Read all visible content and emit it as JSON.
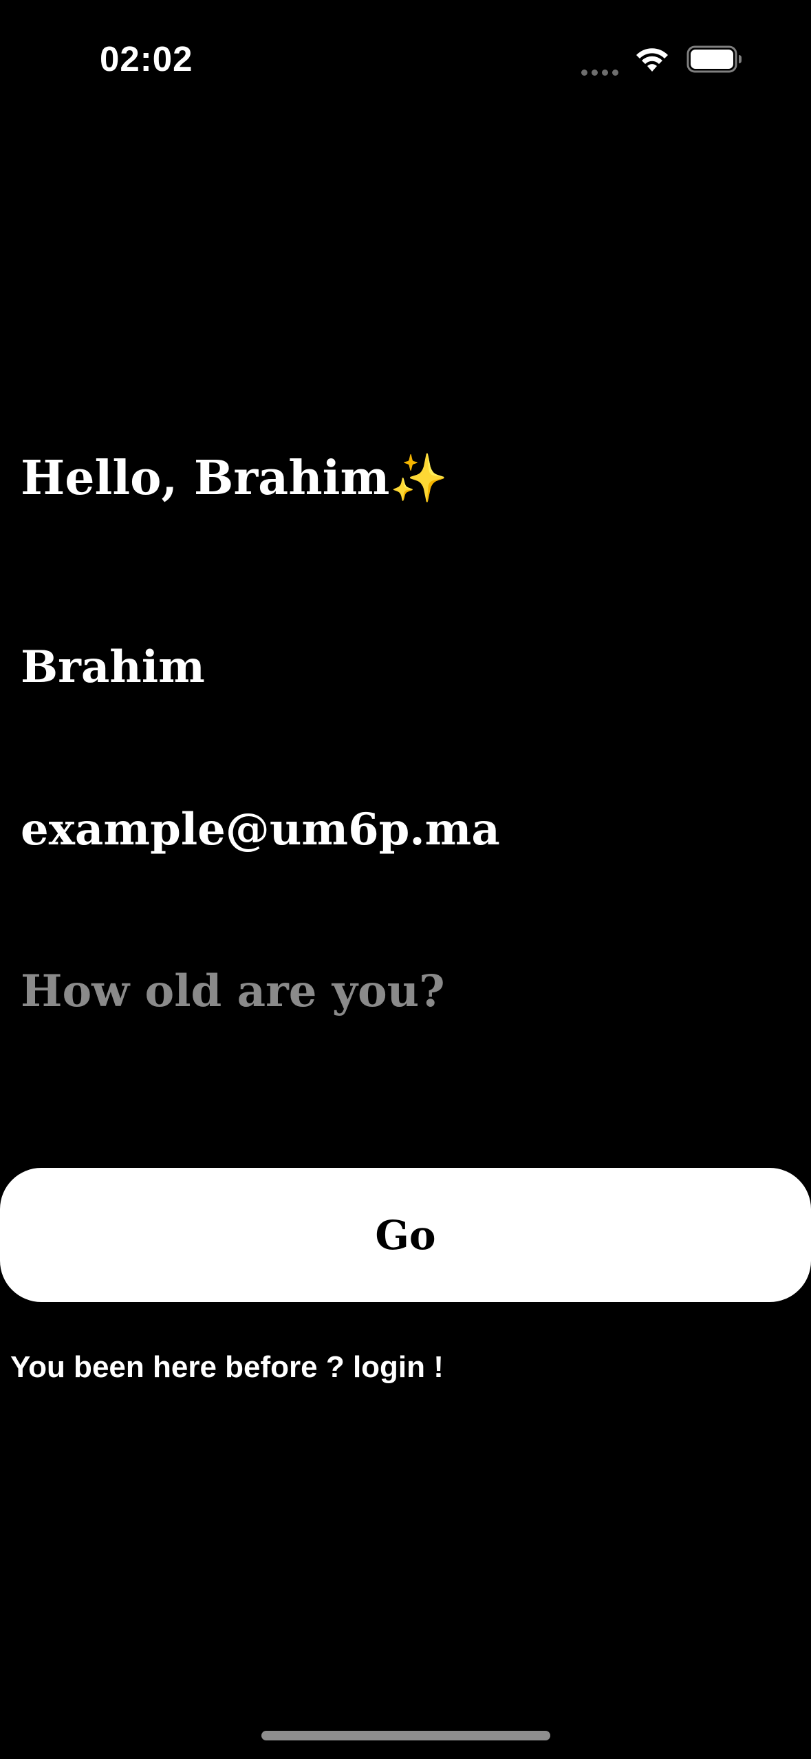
{
  "status_bar": {
    "time": "02:02",
    "icons": [
      "signal-dots-icon",
      "wifi-icon",
      "battery-icon"
    ]
  },
  "greeting": {
    "text": "Hello, Brahim✨"
  },
  "form": {
    "name_value": "Brahim",
    "email_value": "example@um6p.ma",
    "age_placeholder": "How old are you?",
    "age_value": ""
  },
  "actions": {
    "go_label": "Go",
    "login_prompt": "You been here before ? login !"
  },
  "colors": {
    "background": "#000000",
    "text": "#ffffff",
    "placeholder": "#8a8a8a",
    "button_bg": "#ffffff",
    "button_text": "#000000"
  }
}
